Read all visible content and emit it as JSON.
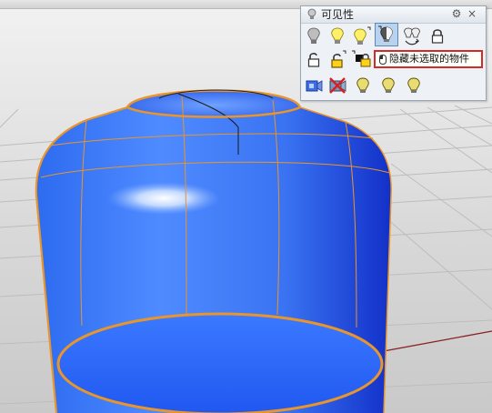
{
  "panel": {
    "title": "可见性",
    "title_icon": "lightbulb-icon",
    "settings_icon": "gear-icon",
    "close_label": "×"
  },
  "tools": [
    {
      "name": "show-tool",
      "icon": "lightbulb-off-icon"
    },
    {
      "name": "show-selected-tool",
      "icon": "lightbulb-on-icon"
    },
    {
      "name": "hide-tool",
      "icon": "lightbulb-on-icon"
    },
    {
      "name": "hide-unselected-tool",
      "icon": "lightbulb-half-icon",
      "active": true
    },
    {
      "name": "swap-hidden-tool",
      "icon": "lightbulb-swap-icon"
    },
    {
      "name": "lock-tool",
      "icon": "lock-closed-icon"
    },
    {
      "name": "unlock-tool",
      "icon": "lock-open-icon"
    },
    {
      "name": "unlock-selected-tool",
      "icon": "lock-yellow-icon"
    },
    {
      "name": "lock-unselected-tool",
      "icon": "lock-half-icon"
    },
    {
      "name": "show-camera-tool",
      "icon": "camera-blue-icon"
    },
    {
      "name": "hide-camera-tool",
      "icon": "camera-cross-icon"
    },
    {
      "name": "show-points-tool",
      "icon": "lightbulb-on-icon"
    },
    {
      "name": "hide-points-tool",
      "icon": "lightbulb-on-icon"
    },
    {
      "name": "show-all-tool",
      "icon": "lightbulb-on-icon"
    }
  ],
  "tooltip": {
    "text": "隐藏未选取的物件",
    "icon": "mouse-icon"
  },
  "colors": {
    "object_blue": "#2f6bff",
    "edge_orange": "#e8952c",
    "tooltip_border": "#d42a2a",
    "axis_red": "#8a2222"
  }
}
